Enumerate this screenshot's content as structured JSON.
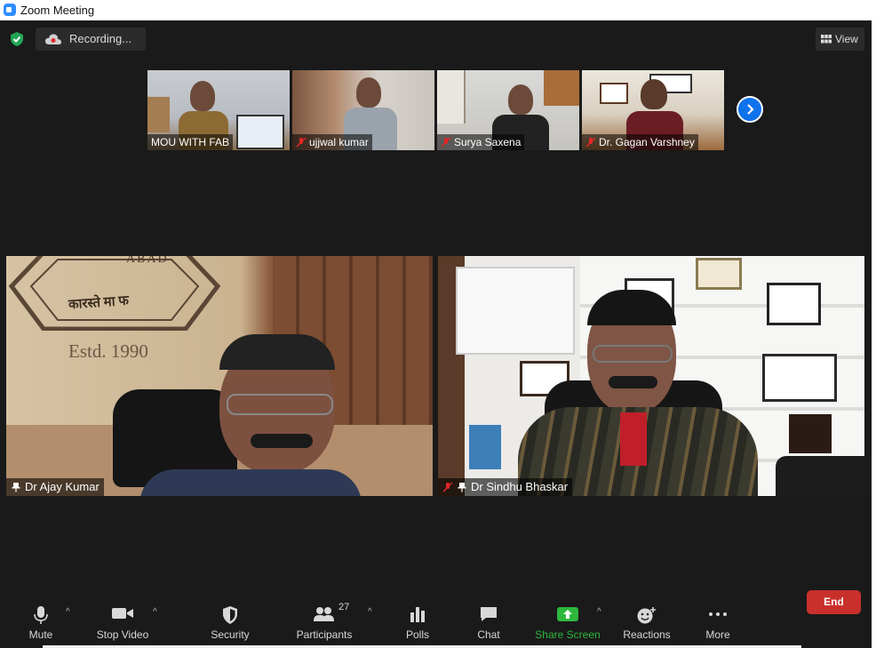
{
  "window": {
    "title": "Zoom Meeting"
  },
  "header": {
    "recording_label": "Recording...",
    "view_label": "View"
  },
  "thumbnails": [
    {
      "name": "MOU WITH FAB",
      "muted": false
    },
    {
      "name": "ujjwal kumar",
      "muted": true
    },
    {
      "name": "Surya Saxena",
      "muted": true
    },
    {
      "name": "Dr. Gagan Varshney",
      "muted": true
    }
  ],
  "main_videos": [
    {
      "name": "Dr Ajay Kumar",
      "pinned": true,
      "muted": false,
      "wall_text": "Estd. 1990",
      "emblem_text": "ABAD",
      "motto_text": "कारस्ते मा फ"
    },
    {
      "name": "Dr Sindhu Bhaskar",
      "pinned": true,
      "muted": true
    }
  ],
  "toolbar": {
    "mute": "Mute",
    "stop_video": "Stop Video",
    "security": "Security",
    "participants": "Participants",
    "participants_count": "27",
    "polls": "Polls",
    "chat": "Chat",
    "share_screen": "Share Screen",
    "reactions": "Reactions",
    "more": "More",
    "end": "End"
  },
  "colors": {
    "share_green": "#2db83d",
    "end_red": "#c9302c",
    "accent_blue": "#0e72ed"
  }
}
